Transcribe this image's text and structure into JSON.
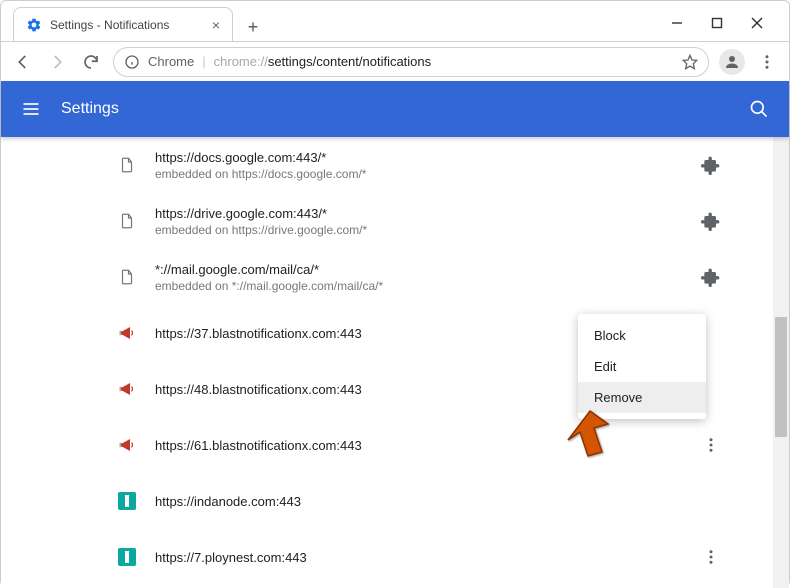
{
  "window": {
    "tab_title": "Settings - Notifications"
  },
  "toolbar": {
    "browser_label": "Chrome",
    "url_prefix": "chrome://",
    "url_path": "settings/content/notifications"
  },
  "settings_header": {
    "title": "Settings"
  },
  "sites": [
    {
      "url": "https://docs.google.com:443/*",
      "sub": "embedded on https://docs.google.com/*",
      "icon": "file",
      "action": "puzzle"
    },
    {
      "url": "https://drive.google.com:443/*",
      "sub": "embedded on https://drive.google.com/*",
      "icon": "file",
      "action": "puzzle"
    },
    {
      "url": "*://mail.google.com/mail/ca/*",
      "sub": "embedded on *://mail.google.com/mail/ca/*",
      "icon": "file",
      "action": "puzzle"
    },
    {
      "url": "https://37.blastnotificationx.com:443",
      "sub": "",
      "icon": "megaphone",
      "action": ""
    },
    {
      "url": "https://48.blastnotificationx.com:443",
      "sub": "",
      "icon": "megaphone",
      "action": ""
    },
    {
      "url": "https://61.blastnotificationx.com:443",
      "sub": "",
      "icon": "megaphone",
      "action": "dots"
    },
    {
      "url": "https://indanode.com:443",
      "sub": "",
      "icon": "teal",
      "action": ""
    },
    {
      "url": "https://7.ploynest.com:443",
      "sub": "",
      "icon": "teal",
      "action": "dots"
    }
  ],
  "context_menu": {
    "items": [
      "Block",
      "Edit",
      "Remove"
    ],
    "hover_index": 2
  }
}
